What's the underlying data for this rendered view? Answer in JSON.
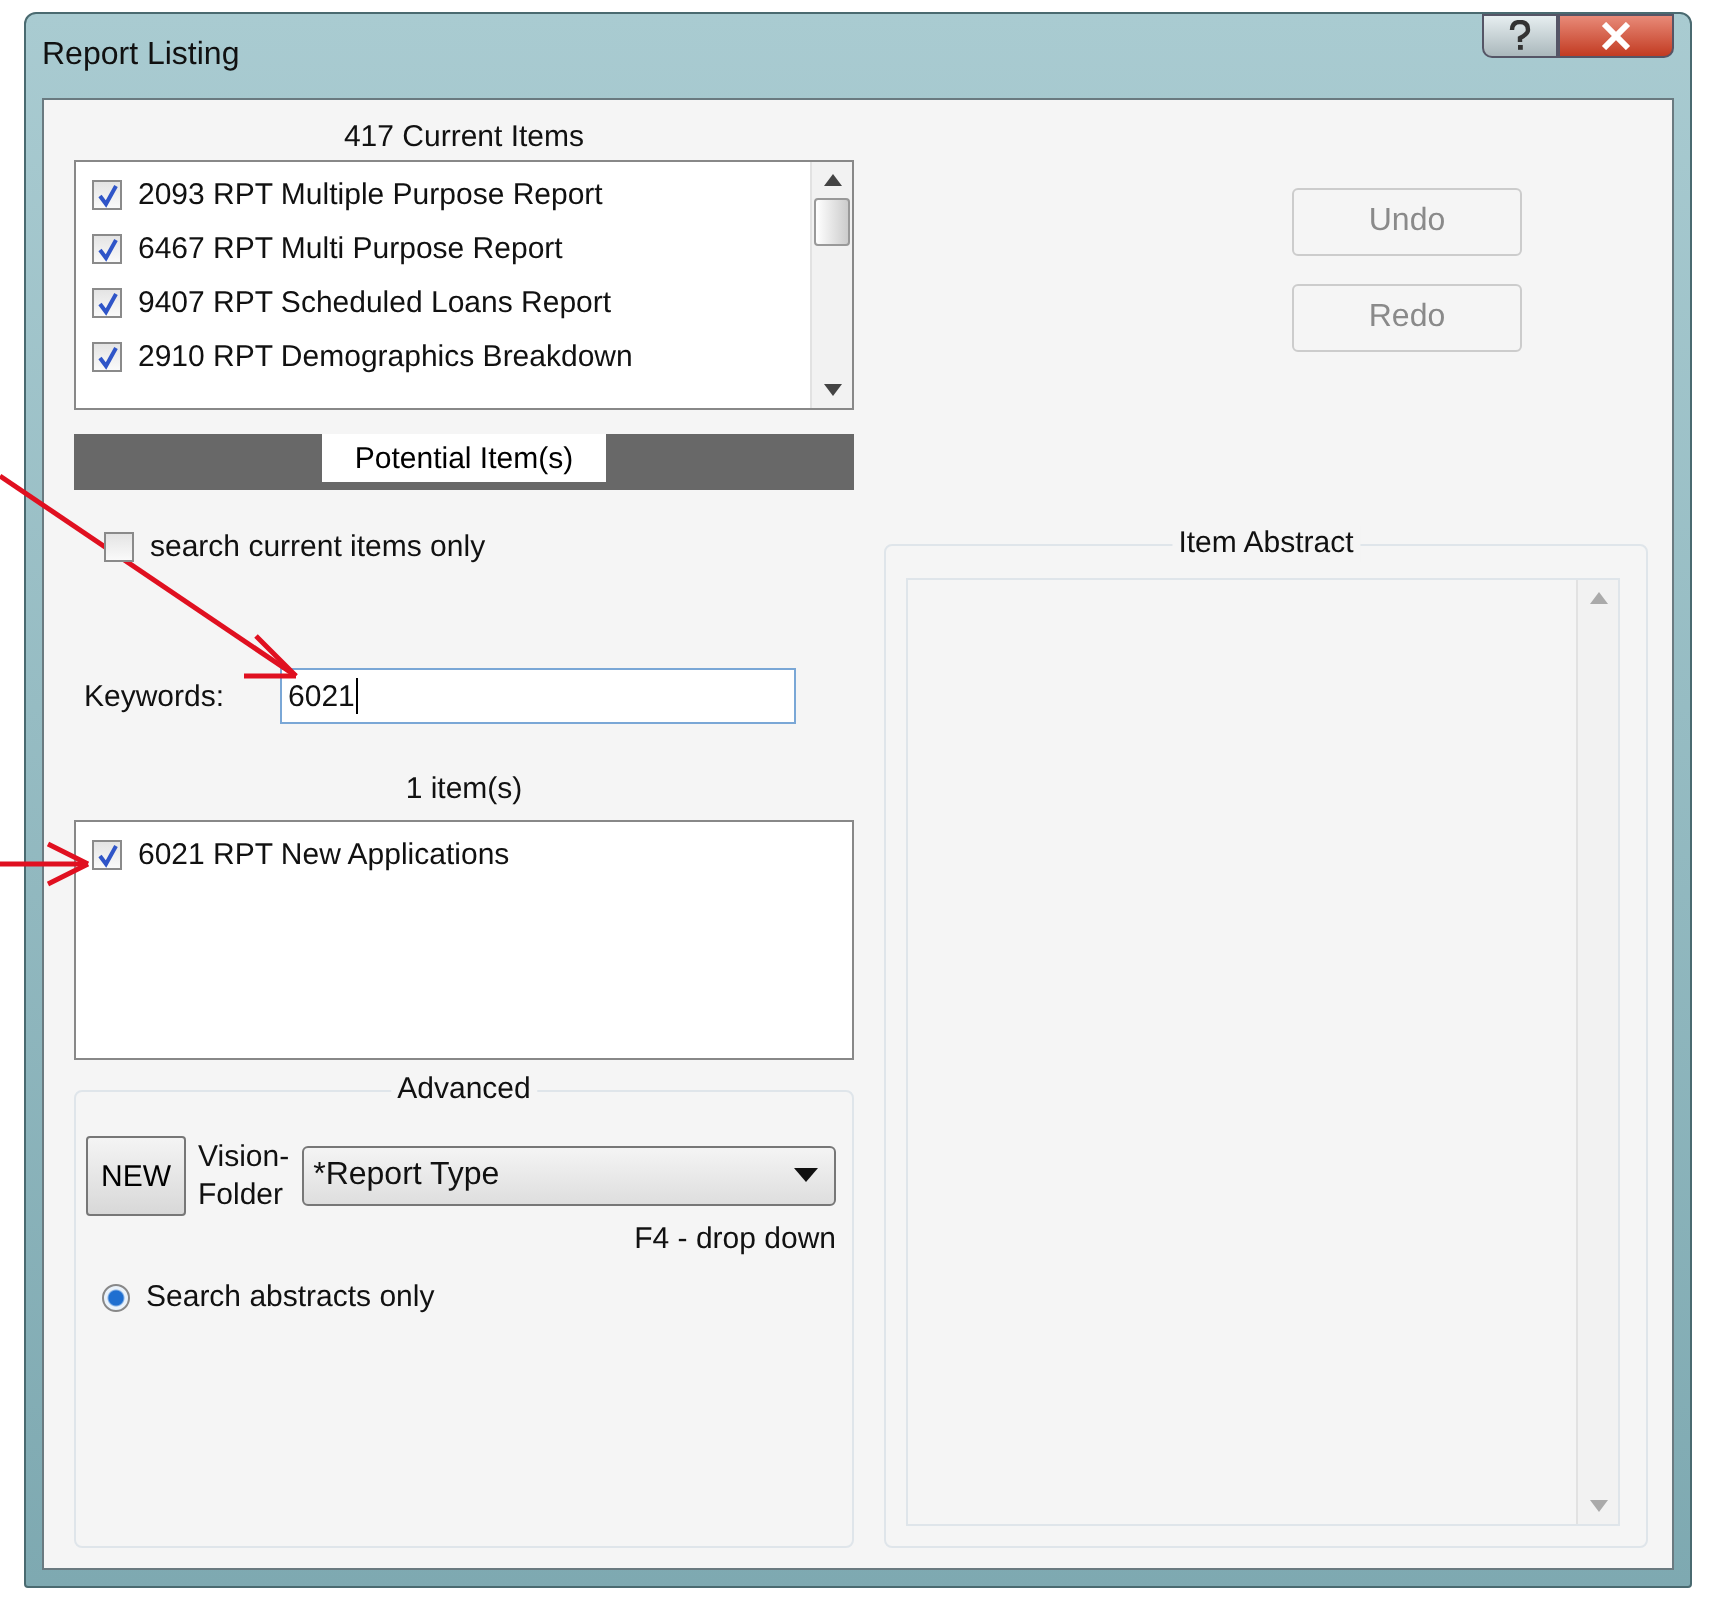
{
  "window": {
    "title": "Report Listing"
  },
  "current_items": {
    "heading": "417 Current Items",
    "items": [
      {
        "label": "2093 RPT Multiple Purpose Report",
        "checked": true
      },
      {
        "label": "6467 RPT Multi Purpose Report",
        "checked": true
      },
      {
        "label": "9407 RPT Scheduled Loans Report",
        "checked": true
      },
      {
        "label": "2910 RPT Demographics Breakdown",
        "checked": true
      }
    ]
  },
  "buttons": [
    {
      "label": "Undo",
      "disabled": true
    },
    {
      "label": "Redo",
      "disabled": true
    }
  ],
  "potential_tab": {
    "label": "Potential Item(s)"
  },
  "search_current_only": {
    "label": "search current items only",
    "checked": false
  },
  "keywords": {
    "label": "Keywords:",
    "value": "6021"
  },
  "results": {
    "heading": "1 item(s)",
    "items": [
      {
        "label": "6021 RPT New Applications",
        "checked": true
      }
    ]
  },
  "advanced": {
    "title": "Advanced",
    "new_button": "NEW",
    "folder_label": [
      "Vision-",
      "Folder"
    ],
    "folder_dropdown": {
      "value": "*Report Type"
    },
    "hint": "F4  -  drop down",
    "search_abstracts_only": {
      "label": "Search abstracts only",
      "selected": true
    }
  },
  "item_abstract": {
    "title": "Item Abstract"
  }
}
